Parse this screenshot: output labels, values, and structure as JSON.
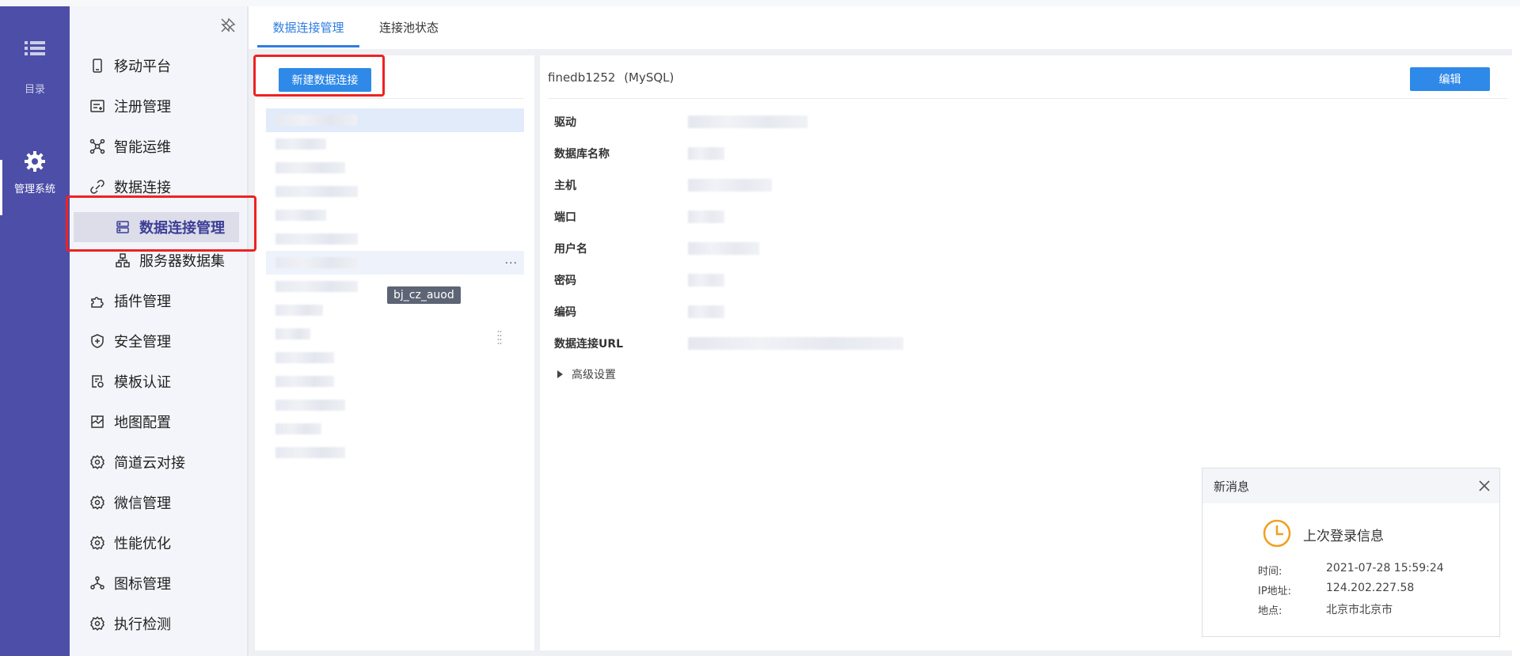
{
  "leftnav": {
    "catalog_label": "目录",
    "admin_label": "管理系统"
  },
  "menu": {
    "items": [
      {
        "label": "移动平台",
        "icon": "mobile-icon"
      },
      {
        "label": "注册管理",
        "icon": "register-icon"
      },
      {
        "label": "智能运维",
        "icon": "ops-icon"
      },
      {
        "label": "数据连接",
        "icon": "link-icon"
      },
      {
        "label": "数据连接管理",
        "icon": "server-icon",
        "active": true
      },
      {
        "label": "服务器数据集",
        "icon": "dataset-icon"
      },
      {
        "label": "插件管理",
        "icon": "plugin-icon"
      },
      {
        "label": "安全管理",
        "icon": "shield-icon"
      },
      {
        "label": "模板认证",
        "icon": "template-icon"
      },
      {
        "label": "地图配置",
        "icon": "map-icon"
      },
      {
        "label": "简道云对接",
        "icon": "gear-icon"
      },
      {
        "label": "微信管理",
        "icon": "gear-icon"
      },
      {
        "label": "性能优化",
        "icon": "gear-icon"
      },
      {
        "label": "图标管理",
        "icon": "nodes-icon"
      },
      {
        "label": "执行检测",
        "icon": "gear-icon"
      }
    ]
  },
  "tabs": [
    {
      "label": "数据连接管理",
      "active": true
    },
    {
      "label": "连接池状态"
    }
  ],
  "list": {
    "new_button": "新建数据连接",
    "tooltip": "bj_cz_auod",
    "more": "..."
  },
  "detail": {
    "name": "finedb1252",
    "type": "(MySQL)",
    "edit_button": "编辑",
    "fields": [
      {
        "label": "驱动"
      },
      {
        "label": "数据库名称"
      },
      {
        "label": "主机"
      },
      {
        "label": "端口"
      },
      {
        "label": "用户名"
      },
      {
        "label": "密码"
      },
      {
        "label": "编码"
      },
      {
        "label": "数据连接URL"
      }
    ],
    "advanced": "高级设置"
  },
  "notification": {
    "header": "新消息",
    "title": "上次登录信息",
    "rows": [
      {
        "key": "时间:",
        "value": "2021-07-28 15:59:24"
      },
      {
        "key": "IP地址:",
        "value": "124.202.227.58"
      },
      {
        "key": "地点:",
        "value": "北京市北京市"
      }
    ]
  },
  "colors": {
    "nav": "#4c4ea8",
    "primary": "#2f89e8",
    "highlight": "#ee2222",
    "clock": "#f0a020"
  }
}
